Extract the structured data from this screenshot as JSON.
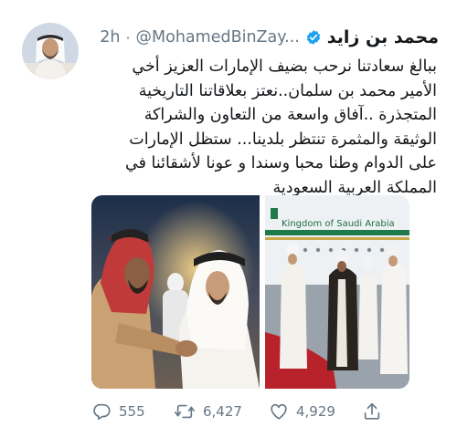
{
  "tweet": {
    "display_name": "محمد بن زايد",
    "handle": "@MohamedBinZay...",
    "separator": "·",
    "time": "2h",
    "text_lines": [
      "ببالغ سعادتنا نرحب بضيف الإمارات العزيز أخي",
      "الأمير محمد بن سلمان..نعتز بعلاقاتنا التاريخية",
      "المتجذرة ..آفاق واسعة من التعاون والشراكة",
      "الوثيقة والمثمرة تنتظر بلدينا... ستظل الإمارات",
      "على الدوام وطنا محبا وسندا و عونا لأشقائنا في",
      "المملكة العربية السعودية"
    ]
  },
  "media": {
    "right_photo_aircraft_text": "Kingdom of Saudi Arabia"
  },
  "actions": {
    "reply_count": "555",
    "retweet_count": "6,427",
    "like_count": "4,929"
  },
  "colors": {
    "text": "#14171a",
    "secondary": "#657786",
    "verified_blue": "#1da1f2"
  },
  "icons": [
    "verified-badge-icon",
    "reply-icon",
    "retweet-icon",
    "like-icon",
    "share-icon"
  ]
}
